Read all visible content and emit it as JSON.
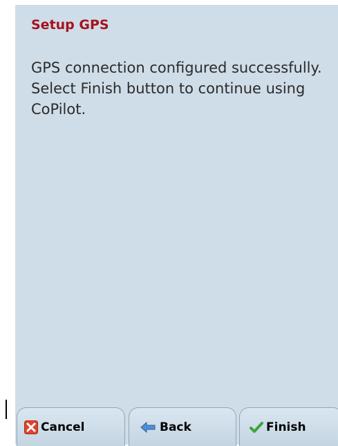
{
  "dialog": {
    "title": "Setup GPS",
    "message": "GPS connection configured successfully. Select Finish button to continue using CoPilot."
  },
  "buttons": {
    "cancel": {
      "label": "Cancel",
      "icon": "cancel-icon"
    },
    "back": {
      "label": "Back",
      "icon": "back-arrow-icon"
    },
    "finish": {
      "label": "Finish",
      "icon": "checkmark-icon"
    }
  },
  "colors": {
    "background": "#cfdde8",
    "title": "#a5121d",
    "text": "#2b2b2b"
  }
}
